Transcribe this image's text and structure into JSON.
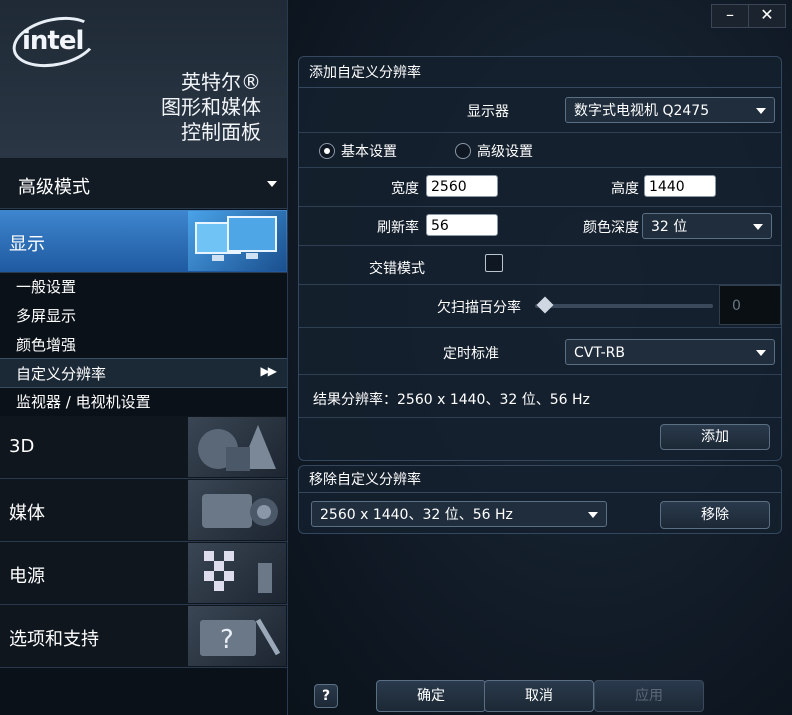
{
  "app": {
    "logo": "intel",
    "title_lines": [
      "英特尔®",
      "图形和媒体",
      "控制面板"
    ]
  },
  "window_controls": {
    "minimize": "–",
    "close": "✕"
  },
  "sidebar": {
    "mode_label": "高级模式",
    "categories": [
      {
        "label": "显示",
        "icon": "display-monitors-icon",
        "active": true
      },
      {
        "label": "3D",
        "icon": "3d-shapes-icon",
        "active": false
      },
      {
        "label": "媒体",
        "icon": "media-camera-icon",
        "active": false
      },
      {
        "label": "电源",
        "icon": "power-flags-icon",
        "active": false
      },
      {
        "label": "选项和支持",
        "icon": "help-toolbox-icon",
        "active": false
      }
    ],
    "display_subitems": [
      {
        "label": "一般设置"
      },
      {
        "label": "多屏显示"
      },
      {
        "label": "颜色增强"
      },
      {
        "label": "自定义分辨率",
        "selected": true,
        "arrows": "▶▶"
      },
      {
        "label": "监视器 / 电视机设置"
      }
    ]
  },
  "add_panel": {
    "title": "添加自定义分辨率",
    "display_label": "显示器",
    "display_value": "数字式电视机 Q2475",
    "basic_label": "基本设置",
    "advanced_label": "高级设置",
    "basic_selected": true,
    "width_label": "宽度",
    "width_value": "2560",
    "height_label": "高度",
    "height_value": "1440",
    "refresh_label": "刷新率",
    "refresh_value": "56",
    "color_depth_label": "颜色深度",
    "color_depth_value": "32 位",
    "interlace_label": "交错模式",
    "interlace_checked": false,
    "underscan_label": "欠扫描百分率",
    "underscan_value": "0",
    "underscan_fraction": 0,
    "timing_label": "定时标准",
    "timing_value": "CVT-RB",
    "result_text": "结果分辨率：2560 x 1440、32 位、56 Hz",
    "add_button": "添加"
  },
  "remove_panel": {
    "title": "移除自定义分辨率",
    "selected": "2560 x 1440、32 位、56 Hz",
    "remove_button": "移除"
  },
  "footer": {
    "help": "?",
    "ok": "确定",
    "cancel": "取消",
    "apply": "应用"
  }
}
